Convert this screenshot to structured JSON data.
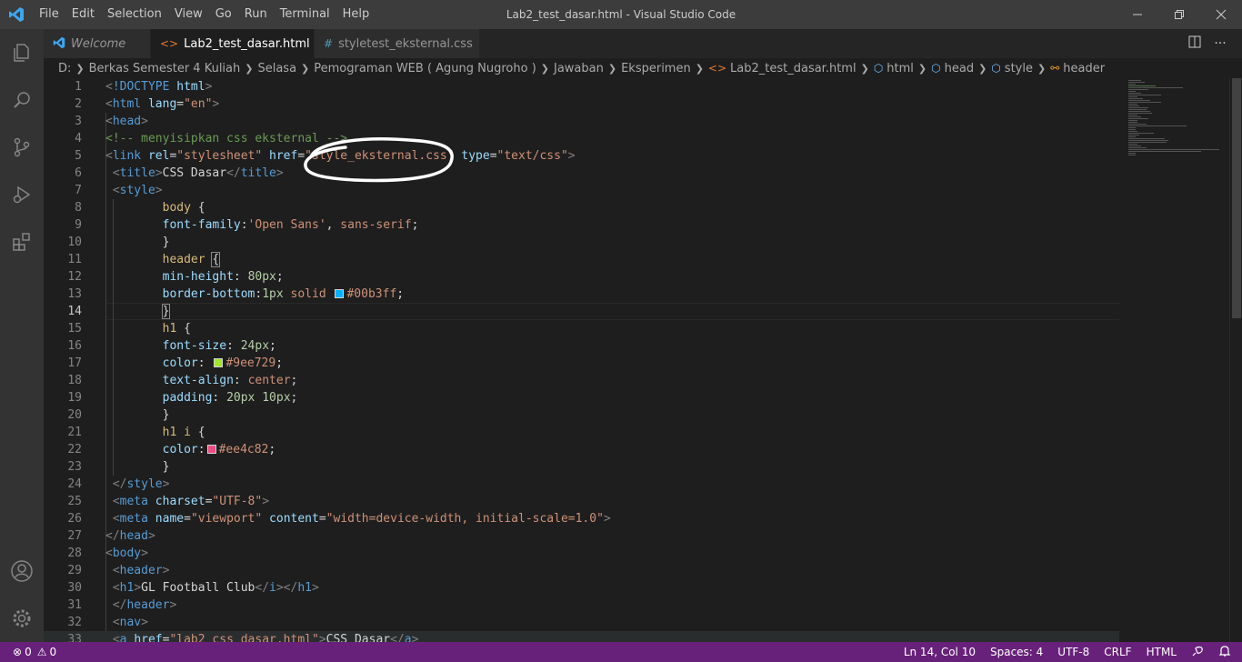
{
  "window": {
    "title": "Lab2_test_dasar.html - Visual Studio Code",
    "menu": [
      "File",
      "Edit",
      "Selection",
      "View",
      "Go",
      "Run",
      "Terminal",
      "Help"
    ],
    "controls": [
      "minimize-icon",
      "restore-icon",
      "close-icon"
    ]
  },
  "activitybar": {
    "items": [
      "explorer-icon",
      "search-icon",
      "source-control-icon",
      "run-debug-icon",
      "extensions-icon"
    ],
    "bottom": [
      "account-icon",
      "settings-gear-icon"
    ]
  },
  "tabs": [
    {
      "label": "Welcome",
      "icon": "vscode-logo-icon",
      "active": false
    },
    {
      "label": "Lab2_test_dasar.html",
      "icon": "html-file-icon",
      "active": true
    },
    {
      "label": "styletest_eksternal.css",
      "icon": "css-file-icon",
      "active": false
    }
  ],
  "breadcrumbs": [
    "D:",
    "Berkas Semester 4 Kuliah",
    "Selasa",
    "Pemograman WEB ( Agung Nugroho )",
    "Jawaban",
    "Eksperimen",
    "Lab2_test_dasar.html",
    "html",
    "head",
    "style",
    "header"
  ],
  "editor": {
    "current_line": 14,
    "line_numbers": [
      "1",
      "2",
      "3",
      "4",
      "5",
      "6",
      "7",
      "8",
      "9",
      "10",
      "11",
      "12",
      "13",
      "14",
      "15",
      "16",
      "17",
      "18",
      "19",
      "20",
      "21",
      "22",
      "23",
      "24",
      "25",
      "26",
      "27",
      "28",
      "29",
      "30",
      "31",
      "32",
      "33"
    ],
    "swatches": {
      "line13": "#00b3ff",
      "line17": "#9ee729",
      "line22": "#ee4c82"
    }
  },
  "statusbar": {
    "problems": "0",
    "warnings": "0",
    "position": "Ln 14, Col 10",
    "spaces": "Spaces: 4",
    "encoding": "UTF-8",
    "eol": "CRLF",
    "language": "HTML"
  }
}
